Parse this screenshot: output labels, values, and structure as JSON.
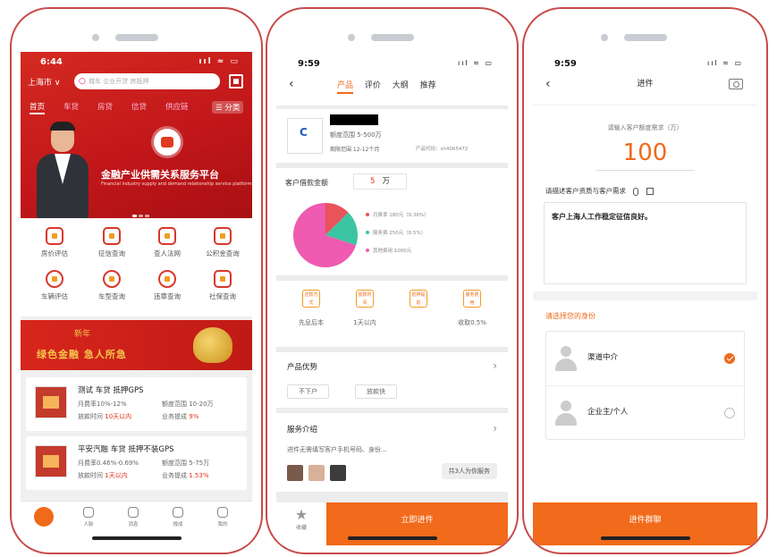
{
  "phone1": {
    "status": {
      "time": "6:44",
      "icons": "ııl ≈ ▭"
    },
    "city": "上海市 ∨",
    "search_placeholder": "城车 企业开贷 房抵押",
    "tabs": [
      "首页",
      "车贷",
      "房贷",
      "信贷",
      "供应链",
      "☰ 分类"
    ],
    "hero": {
      "title": "金融产业供需关系服务平台",
      "subtitle": "Financial industry supply and demand relationship service platform"
    },
    "grid": [
      {
        "label": "房价评估",
        "icon": "house-icon"
      },
      {
        "label": "征信查询",
        "icon": "shield-icon"
      },
      {
        "label": "查人法网",
        "icon": "scales-icon"
      },
      {
        "label": "公积金查询",
        "icon": "home-icon"
      },
      {
        "label": "车辆评估",
        "icon": "coin-icon"
      },
      {
        "label": "车型查询",
        "icon": "car-search-icon"
      },
      {
        "label": "违章查询",
        "icon": "violation-icon"
      },
      {
        "label": "社保查询",
        "icon": "social-security-icon"
      }
    ],
    "banner": {
      "text": "绿色金融 急人所急",
      "subtext": "新年"
    },
    "cards": [
      {
        "title": "测试 车贷 抵押GPS",
        "rate_label": "月费率10%-12%",
        "range_label": "额度范围 10-20万",
        "time_label": "放款时间",
        "time_value": "10天以内",
        "commission_label": "业务提成",
        "commission_value": "9%"
      },
      {
        "title": "平安汽融 车贷 抵押不装GPS",
        "rate_label": "月费率0.46%-0.69%",
        "range_label": "额度范围 5-75万",
        "time_label": "放款时间",
        "time_value": "1天以内",
        "commission_label": "业务提成",
        "commission_value": "1.53%"
      }
    ],
    "tabbar": [
      "",
      "人脉",
      "消息",
      "报成",
      "我的"
    ]
  },
  "phone2": {
    "status": {
      "time": "9:59",
      "icons": "ııl ≈ ▭"
    },
    "tabs": [
      "产品",
      "评价",
      "大纲",
      "推荐"
    ],
    "product": {
      "range": "额度范围 5-500万",
      "period": "期限范围 12-12个月",
      "code": "产品代码：sh4065472"
    },
    "loan_label": "客户借款金额",
    "loan_amount": "5",
    "loan_unit": "万",
    "fees": [
      {
        "label": "月费率  180元（0.36%）",
        "color": "#e9535a"
      },
      {
        "label": "服务费  250元（0.5%）",
        "color": "#3cc5a2"
      },
      {
        "label": "其他费用 1000元",
        "color": "#ee5bb0"
      }
    ],
    "chart_data": {
      "type": "pie",
      "categories": [
        "月费率",
        "服务费",
        "其他费用"
      ],
      "values": [
        180,
        250,
        1000
      ],
      "colors": [
        "#e9535a",
        "#3cc5a2",
        "#ee5bb0"
      ]
    },
    "terms": [
      {
        "tag": "还款方式",
        "value": "先息后本"
      },
      {
        "tag": "放款时间",
        "value": "1天以内"
      },
      {
        "tag": "抵押提前",
        "value": ""
      },
      {
        "tag": "服务费用",
        "value": "收取0.5%"
      }
    ],
    "advantage_title": "产品优势",
    "advantage_tags": [
      "不下户",
      "放款快"
    ],
    "service_title": "服务介绍",
    "service_desc": "进件无需填写客户手机号码、身份...",
    "service_count": "共3人为你服务",
    "fav_label": "收藏",
    "apply_label": "立即进件"
  },
  "phone3": {
    "status": {
      "time": "9:59",
      "icons": "ııl ≈ ▭"
    },
    "title": "进件",
    "amount_prompt": "请输入客户额度需求（万）",
    "amount_value": "100",
    "desc_label": "请描述客户资质与客户需求",
    "desc_value": "客户上海人工作稳定征信良好。",
    "role_prompt": "请选择您的身份",
    "roles": [
      {
        "label": "渠道中介",
        "selected": true
      },
      {
        "label": "企业主/个人",
        "selected": false
      }
    ],
    "submit_label": "进件群聊"
  }
}
